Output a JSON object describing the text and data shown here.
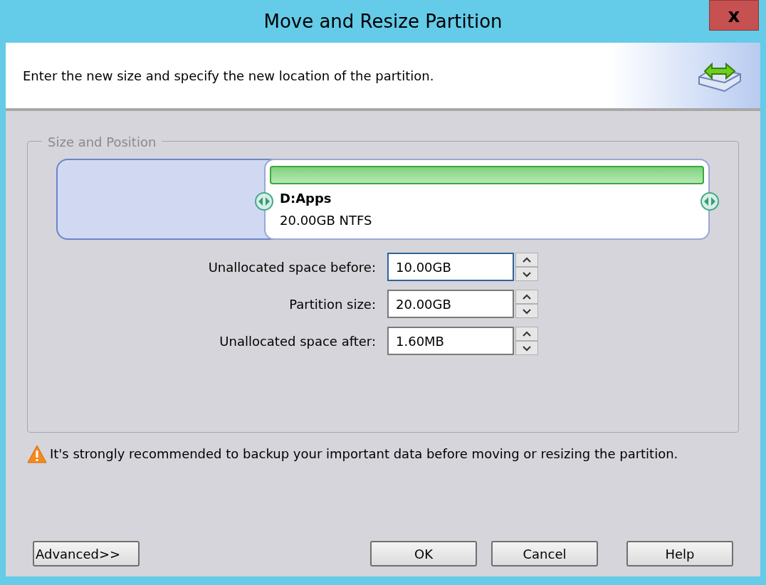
{
  "window": {
    "title": "Move and Resize Partition",
    "close": "x"
  },
  "header": {
    "text": "Enter the new size and specify the new location of the partition."
  },
  "group": {
    "title": "Size and Position"
  },
  "partition": {
    "name": "D:Apps",
    "details": "20.00GB NTFS"
  },
  "fields": [
    {
      "label": "Unallocated space before:",
      "value": "10.00GB",
      "focused": true
    },
    {
      "label": "Partition size:",
      "value": "20.00GB",
      "focused": false
    },
    {
      "label": "Unallocated space after:",
      "value": "1.60MB",
      "focused": false
    }
  ],
  "warning": "It's strongly recommended to backup your important data before moving or resizing the partition.",
  "buttons": [
    {
      "label": "Advanced>>",
      "kind": "left"
    },
    {
      "label": "OK",
      "kind": "right"
    },
    {
      "label": "Cancel",
      "kind": "right"
    },
    {
      "label": "Help",
      "kind": "right"
    }
  ]
}
